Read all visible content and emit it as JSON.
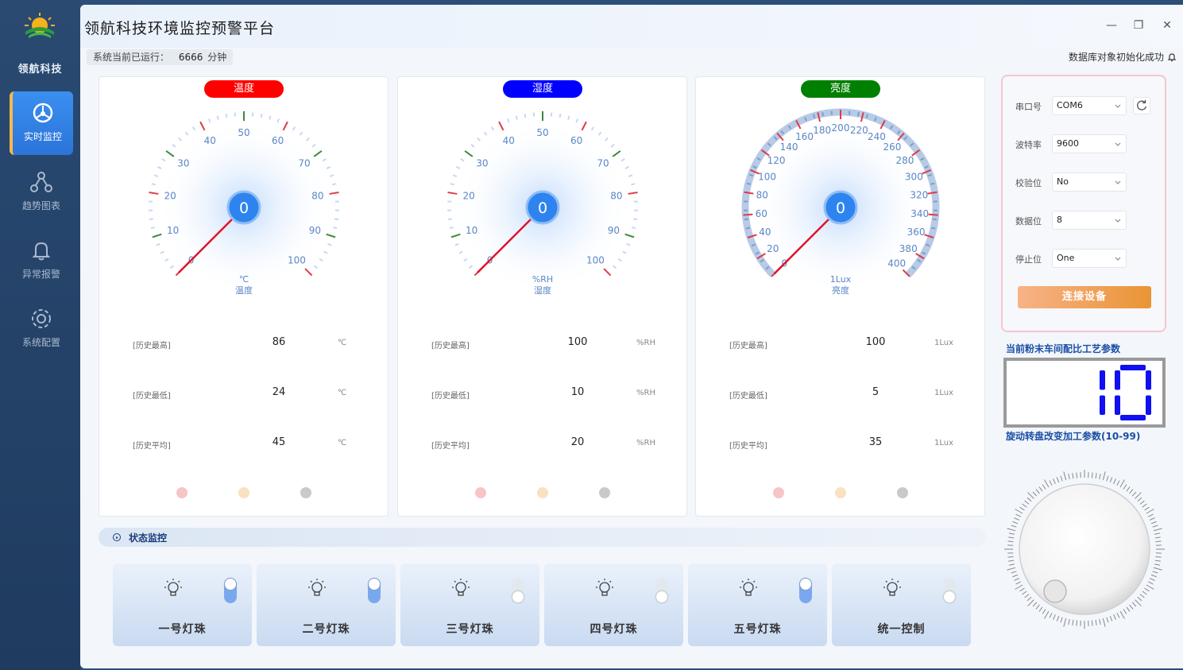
{
  "brand": {
    "name": "领航科技"
  },
  "nav": [
    {
      "label": "实时监控",
      "icon": "dashboard-icon",
      "active": true
    },
    {
      "label": "趋势图表",
      "icon": "trend-chart-icon",
      "active": false
    },
    {
      "label": "异常报警",
      "icon": "bell-icon",
      "active": false
    },
    {
      "label": "系统配置",
      "icon": "gear-icon",
      "active": false
    }
  ],
  "window": {
    "title": "领航科技环境监控预警平台",
    "minimize": "—",
    "restore": "❐",
    "close": "✕"
  },
  "status": {
    "run_prefix": "系统当前已运行：",
    "run_value": "6666",
    "run_unit": "分钟",
    "db_message": "数据库对象初始化成功"
  },
  "gauges": [
    {
      "title": "温度",
      "color": "#ff0000",
      "value": "0",
      "unit": "℃",
      "name": "温度",
      "min": 0,
      "max": 100,
      "ticks": [
        "0",
        "10",
        "20",
        "30",
        "40",
        "50",
        "60",
        "70",
        "80",
        "90",
        "100"
      ],
      "stats": {
        "max_label": "[历史最高]",
        "max": "86",
        "min_label": "[历史最低]",
        "min": "24",
        "avg_label": "[历史平均]",
        "avg": "45",
        "unit": "℃"
      }
    },
    {
      "title": "湿度",
      "color": "#0000ff",
      "value": "0",
      "unit": "%RH",
      "name": "湿度",
      "min": 0,
      "max": 100,
      "ticks": [
        "0",
        "10",
        "20",
        "30",
        "40",
        "50",
        "60",
        "70",
        "80",
        "90",
        "100"
      ],
      "stats": {
        "max_label": "[历史最高]",
        "max": "100",
        "min_label": "[历史最低]",
        "min": "10",
        "avg_label": "[历史平均]",
        "avg": "20",
        "unit": "%RH"
      }
    },
    {
      "title": "亮度",
      "color": "#008000",
      "value": "0",
      "unit": "1Lux",
      "name": "亮度",
      "min": 0,
      "max": 400,
      "ticks": [
        "0",
        "20",
        "40",
        "60",
        "80",
        "100",
        "120",
        "140",
        "160",
        "180",
        "200",
        "220",
        "240",
        "260",
        "280",
        "300",
        "320",
        "340",
        "360",
        "380",
        "400"
      ],
      "stats": {
        "max_label": "[历史最高]",
        "max": "100",
        "min_label": "[历史最低]",
        "min": "5",
        "avg_label": "[历史平均]",
        "avg": "35",
        "unit": "1Lux"
      }
    }
  ],
  "lamp_colors": [
    "#f7c5c5",
    "#f9e1c2",
    "#c9c9c9"
  ],
  "serial": {
    "port_label": "串口号",
    "port": "COM6",
    "baud_label": "波特率",
    "baud": "9600",
    "parity_label": "校验位",
    "parity": "No",
    "databits_label": "数据位",
    "databits": "8",
    "stopbits_label": "停止位",
    "stopbits": "One",
    "connect": "连接设备"
  },
  "process": {
    "title": "当前粉末车间配比工艺参数",
    "value": "10",
    "subtitle": "旋动转盘改变加工参数(10-99)",
    "seg_color": "#1010f0"
  },
  "section": {
    "title": "状态监控"
  },
  "lights": [
    {
      "name": "一号灯珠",
      "on": true
    },
    {
      "name": "二号灯珠",
      "on": true
    },
    {
      "name": "三号灯珠",
      "on": false
    },
    {
      "name": "四号灯珠",
      "on": false
    },
    {
      "name": "五号灯珠",
      "on": true
    },
    {
      "name": "统一控制",
      "on": false
    }
  ]
}
